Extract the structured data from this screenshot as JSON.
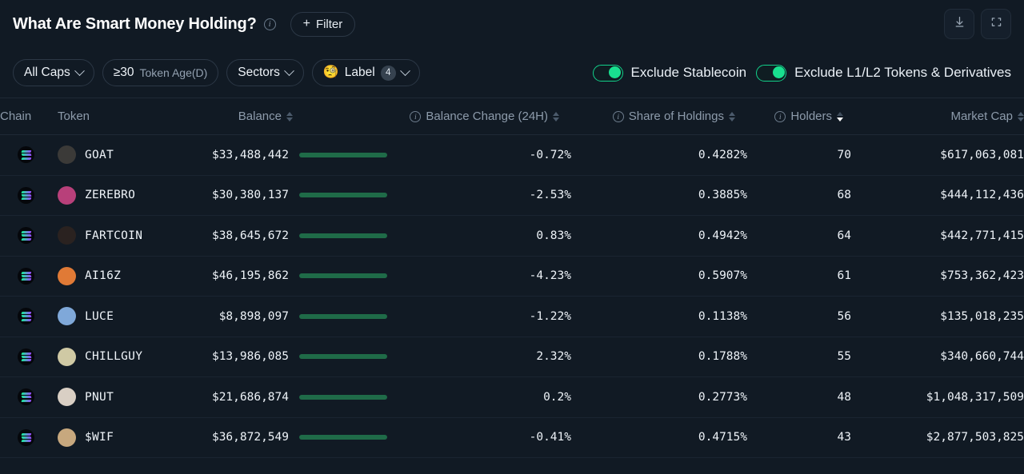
{
  "header": {
    "title": "What Are Smart Money Holding?",
    "info_icon": "info-icon",
    "filter_button": "Filter",
    "plus": "+",
    "download_icon": "download-icon",
    "fullscreen_icon": "fullscreen-icon"
  },
  "filters": {
    "caps": {
      "label": "All Caps",
      "chevron": "chevron-down-icon"
    },
    "token_age": {
      "value": "≥30",
      "label": "Token Age(D)"
    },
    "sectors": {
      "label": "Sectors",
      "chevron": "chevron-down-icon"
    },
    "label": {
      "emoji": "🧐",
      "label": "Label",
      "count": "4",
      "chevron": "chevron-down-icon"
    },
    "toggles": [
      {
        "label": "Exclude Stablecoin",
        "on": true
      },
      {
        "label": "Exclude L1/L2 Tokens & Derivatives",
        "on": true
      }
    ]
  },
  "table": {
    "columns": [
      {
        "key": "chain",
        "label": "Chain",
        "align": "left",
        "info": false,
        "sortable": false
      },
      {
        "key": "token",
        "label": "Token",
        "align": "left",
        "info": false,
        "sortable": false
      },
      {
        "key": "balance",
        "label": "Balance",
        "align": "right",
        "info": false,
        "sortable": true,
        "sorted": "none"
      },
      {
        "key": "balance_change",
        "label": "Balance Change (24H)",
        "align": "right",
        "info": true,
        "sortable": true,
        "sorted": "none"
      },
      {
        "key": "share",
        "label": "Share of Holdings",
        "align": "right",
        "info": true,
        "sortable": true,
        "sorted": "none"
      },
      {
        "key": "holders",
        "label": "Holders",
        "align": "right",
        "info": true,
        "sortable": true,
        "sorted": "desc"
      },
      {
        "key": "market_cap",
        "label": "Market Cap",
        "align": "right",
        "info": false,
        "sortable": true,
        "sorted": "none"
      }
    ],
    "rows": [
      {
        "chain": "solana",
        "token": "GOAT",
        "balance": "$33,488,442",
        "balance_raw": 33488442,
        "change": "-0.72%",
        "change_dir": "neg",
        "share": "0.4282%",
        "holders": "70",
        "market_cap": "$617,063,081",
        "avatar": "#3b3a38"
      },
      {
        "chain": "solana",
        "token": "ZEREBRO",
        "balance": "$30,380,137",
        "balance_raw": 30380137,
        "change": "-2.53%",
        "change_dir": "neg",
        "share": "0.3885%",
        "holders": "68",
        "market_cap": "$444,112,436",
        "avatar": "#b8407a"
      },
      {
        "chain": "solana",
        "token": "FARTCOIN",
        "balance": "$38,645,672",
        "balance_raw": 38645672,
        "change": "0.83%",
        "change_dir": "pos",
        "share": "0.4942%",
        "holders": "64",
        "market_cap": "$442,771,415",
        "avatar": "#2a2220"
      },
      {
        "chain": "solana",
        "token": "AI16Z",
        "balance": "$46,195,862",
        "balance_raw": 46195862,
        "change": "-4.23%",
        "change_dir": "neg",
        "share": "0.5907%",
        "holders": "61",
        "market_cap": "$753,362,423",
        "avatar": "#e07a36"
      },
      {
        "chain": "solana",
        "token": "LUCE",
        "balance": "$8,898,097",
        "balance_raw": 8898097,
        "change": "-1.22%",
        "change_dir": "neg",
        "share": "0.1138%",
        "holders": "56",
        "market_cap": "$135,018,235",
        "avatar": "#7fa8d9"
      },
      {
        "chain": "solana",
        "token": "CHILLGUY",
        "balance": "$13,986,085",
        "balance_raw": 13986085,
        "change": "2.32%",
        "change_dir": "pos",
        "share": "0.1788%",
        "holders": "55",
        "market_cap": "$340,660,744",
        "avatar": "#cfc9a4"
      },
      {
        "chain": "solana",
        "token": "PNUT",
        "balance": "$21,686,874",
        "balance_raw": 21686874,
        "change": "0.2%",
        "change_dir": "pos",
        "share": "0.2773%",
        "holders": "48",
        "market_cap": "$1,048,317,509",
        "avatar": "#d9cfc4"
      },
      {
        "chain": "solana",
        "token": "$WIF",
        "balance": "$36,872,549",
        "balance_raw": 36872549,
        "change": "-0.41%",
        "change_dir": "neg",
        "share": "0.4715%",
        "holders": "43",
        "market_cap": "$2,877,503,825",
        "avatar": "#c7a87e"
      }
    ]
  },
  "colors": {
    "background": "#111a24",
    "positive": "#1fcf83",
    "negative": "#e05a68",
    "accent_green": "#19e08f",
    "bar_fill": "#45dd94",
    "bar_track": "#1f6b48"
  }
}
